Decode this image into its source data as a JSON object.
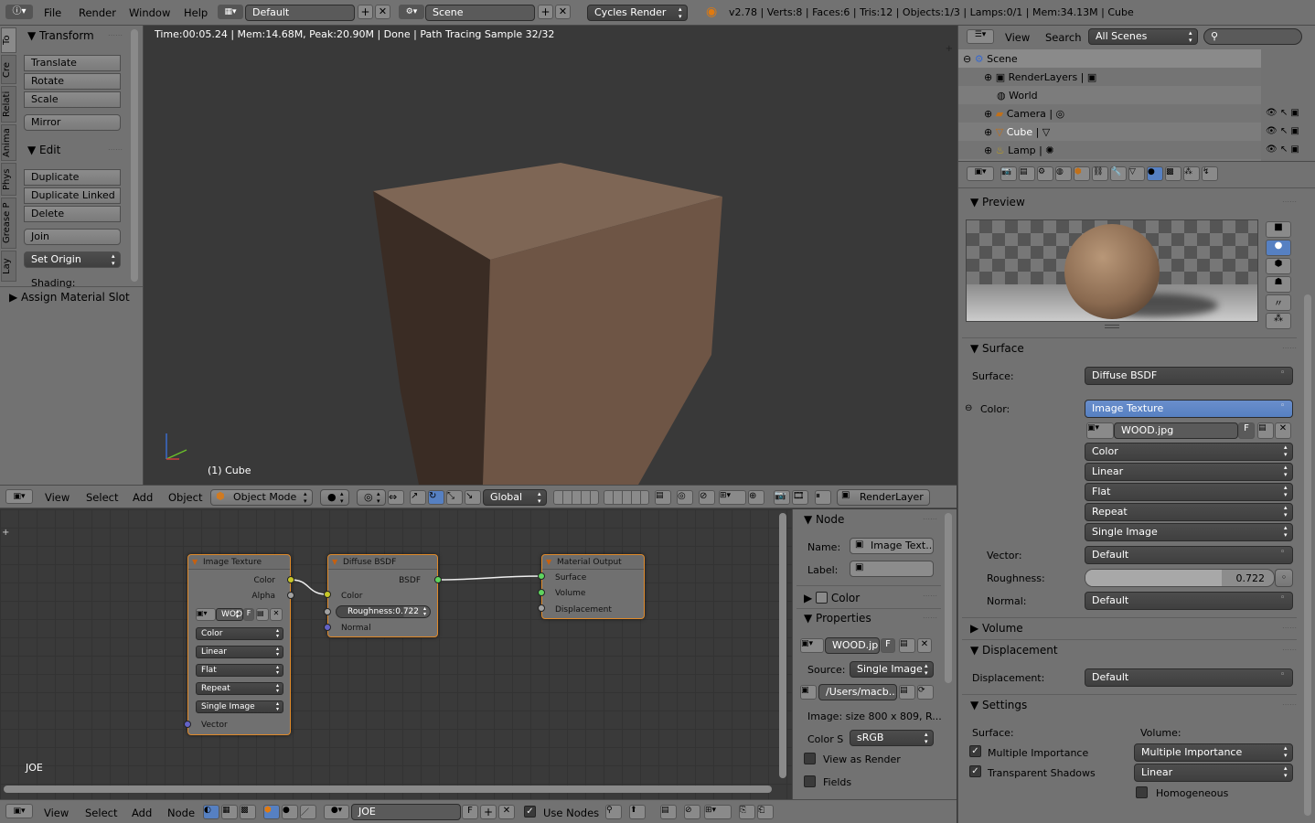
{
  "top": {
    "menus": [
      "File",
      "Render",
      "Window",
      "Help"
    ],
    "layout": "Default",
    "scene": "Scene",
    "engine": "Cycles Render",
    "stats": "v2.78 | Verts:8 | Faces:6 | Tris:12 | Objects:1/3 | Lamps:0/1 | Mem:34.13M | Cube"
  },
  "tools": {
    "tabs": [
      "To",
      "Cre",
      "Relati",
      "Anima",
      "Phys",
      "Grease P",
      "Lay"
    ],
    "transform_title": "Transform",
    "translate": "Translate",
    "rotate": "Rotate",
    "scale": "Scale",
    "mirror": "Mirror",
    "edit_title": "Edit",
    "duplicate": "Duplicate",
    "duplicate_linked": "Duplicate Linked",
    "delete": "Delete",
    "join": "Join",
    "set_origin": "Set Origin",
    "shading": "Shading:",
    "assign": "Assign Material Slot"
  },
  "viewport": {
    "status": "Time:00:05.24 | Mem:14.68M, Peak:20.90M | Done | Path Tracing Sample 32/32",
    "object_label": "(1) Cube",
    "header": {
      "view": "View",
      "select": "Select",
      "add": "Add",
      "object": "Object",
      "mode": "Object Mode",
      "orientation": "Global",
      "render_layer": "RenderLayer"
    }
  },
  "outliner": {
    "view": "View",
    "search": "Search",
    "filter": "All Scenes",
    "items": [
      {
        "name": "Scene"
      },
      {
        "name": "RenderLayers"
      },
      {
        "name": "World"
      },
      {
        "name": "Camera"
      },
      {
        "name": "Cube"
      },
      {
        "name": "Lamp"
      }
    ]
  },
  "properties": {
    "preview": "Preview",
    "surface_title": "Surface",
    "surface_label": "Surface:",
    "surface_value": "Diffuse BSDF",
    "color_label": "Color:",
    "color_value": "Image Texture",
    "image_name": "WOOD.jpg",
    "image_f": "F",
    "color_space": "Color",
    "interpolation": "Linear",
    "projection": "Flat",
    "extension": "Repeat",
    "source": "Single Image",
    "vector_label": "Vector:",
    "vector_value": "Default",
    "roughness_label": "Roughness:",
    "roughness_value": "0.722",
    "roughness_fraction": 0.722,
    "normal_label": "Normal:",
    "normal_value": "Default",
    "volume_title": "Volume",
    "displacement_title": "Displacement",
    "displacement_label": "Displacement:",
    "displacement_value": "Default",
    "settings_title": "Settings",
    "settings_surface": "Surface:",
    "settings_volume": "Volume:",
    "mult_imp": "Multiple Importance",
    "trans_shadows": "Transparent Shadows",
    "vol_sampling": "Multiple Importance",
    "vol_interp": "Linear",
    "homogeneous": "Homogeneous"
  },
  "nodes": {
    "image_texture": {
      "title": "Image Texture",
      "color": "Color",
      "alpha": "Alpha",
      "image": "WOO",
      "f": "F",
      "color_space": "Color",
      "interp": "Linear",
      "proj": "Flat",
      "ext": "Repeat",
      "source": "Single Image",
      "vector": "Vector"
    },
    "diffuse": {
      "title": "Diffuse BSDF",
      "bsdf": "BSDF",
      "color": "Color",
      "roughness": "Roughness:",
      "roughness_value": "0.722",
      "normal": "Normal"
    },
    "output": {
      "title": "Material Output",
      "surface": "Surface",
      "volume": "Volume",
      "displacement": "Displacement"
    },
    "material_label": "JOE"
  },
  "node_panel": {
    "node_title": "Node",
    "name_label": "Name:",
    "name_value": "Image Text...",
    "label_label": "Label:",
    "color_title": "Color",
    "properties_title": "Properties",
    "image": "WOOD.jp",
    "f": "F",
    "source_label": "Source:",
    "source_value": "Single Image",
    "path": "/Users/macb...",
    "image_info": "Image: size 800 x 809, R...",
    "colorspace_label": "Color S",
    "colorspace_value": "sRGB",
    "view_as_render": "View as Render",
    "fields": "Fields"
  },
  "node_header": {
    "view": "View",
    "select": "Select",
    "add": "Add",
    "node": "Node",
    "material": "JOE",
    "f": "F",
    "use_nodes": "Use Nodes"
  }
}
